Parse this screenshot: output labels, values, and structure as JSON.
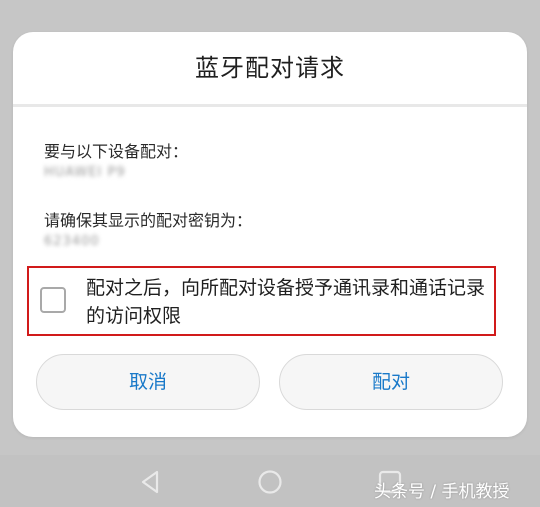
{
  "dialog": {
    "title": "蓝牙配对请求",
    "pair_with_label": "要与以下设备配对：",
    "device_name": "HUAWEI P9",
    "passkey_label": "请确保其显示的配对密钥为：",
    "passkey_value": "623400",
    "checkbox_text": "配对之后，向所配对设备授予通讯录和通话记录的访问权限",
    "checkbox_checked": false,
    "cancel_label": "取消",
    "pair_label": "配对"
  },
  "highlight_color": "#d11a1a",
  "accent_color": "#1979c9",
  "navbar": {
    "icons": [
      "back-icon",
      "home-icon",
      "recent-apps-icon"
    ]
  },
  "watermark": "头条号 / 手机教授"
}
